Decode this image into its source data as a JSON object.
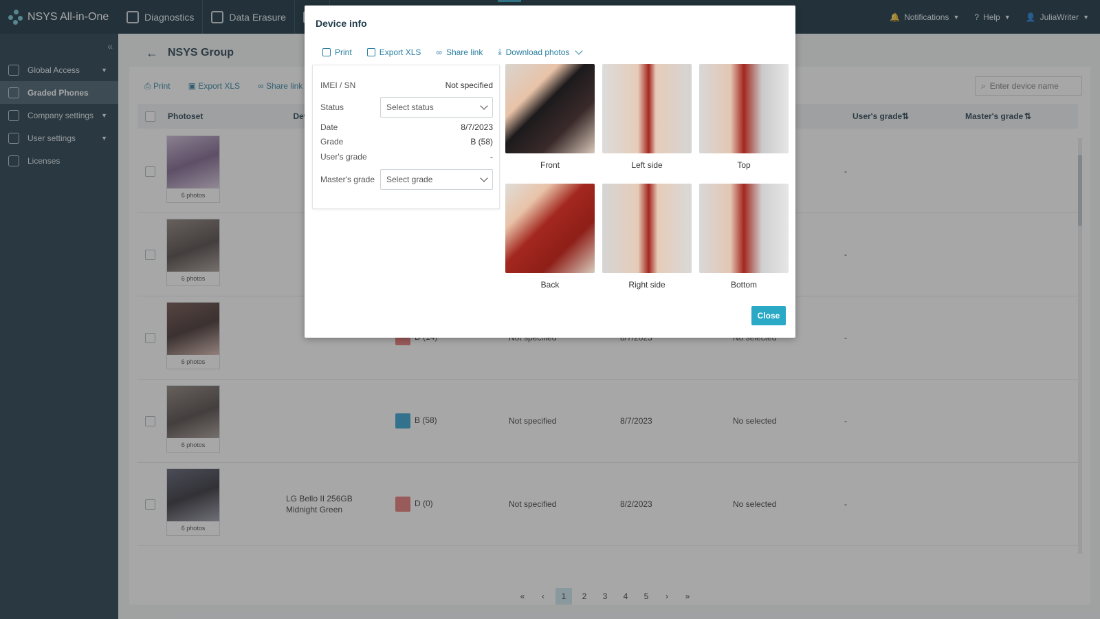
{
  "app": {
    "brand": "NSYS All-in-One",
    "nav": [
      "Diagnostics",
      "Data Erasure"
    ],
    "notifications": "Notifications",
    "help": "Help",
    "user": "JuliaWriter"
  },
  "sidebar": {
    "items": [
      {
        "label": "Global Access",
        "icon": "check-icon",
        "has_caret": true
      },
      {
        "label": "Graded Phones",
        "icon": "phone-icon",
        "active": true
      },
      {
        "label": "Company settings",
        "icon": "sliders-icon",
        "has_caret": true
      },
      {
        "label": "User settings",
        "icon": "gear-icon",
        "has_caret": true
      },
      {
        "label": "Licenses",
        "icon": "document-icon"
      }
    ]
  },
  "page": {
    "title": "NSYS Group",
    "toolbar": {
      "print": "Print",
      "export": "Export XLS",
      "share": "Share link"
    },
    "search_placeholder": "Enter device name",
    "columns": {
      "photoset": "Photoset",
      "device": "Device",
      "users_grade": "User's grade",
      "masters_grade": "Master's grade"
    },
    "rows": [
      {
        "photos": "6 photos",
        "device": "",
        "grade": "",
        "imei": "",
        "date": "",
        "status": "",
        "users_grade": "-"
      },
      {
        "photos": "6 photos",
        "device": "",
        "grade": "",
        "imei": "",
        "date": "",
        "status": "",
        "users_grade": "-"
      },
      {
        "photos": "6 photos",
        "device": "",
        "grade": "D (14)",
        "imei": "Not specified",
        "date": "8/7/2023",
        "status": "No selected",
        "users_grade": "-"
      },
      {
        "photos": "6 photos",
        "device": "",
        "grade": "B (58)",
        "imei": "Not specified",
        "date": "8/7/2023",
        "status": "No selected",
        "users_grade": "-"
      },
      {
        "photos": "6 photos",
        "device": "LG Bello II 256GB Midnight Green",
        "grade": "D (0)",
        "imei": "Not specified",
        "date": "8/2/2023",
        "status": "No selected",
        "users_grade": "-"
      }
    ],
    "pagination": {
      "pages": [
        "1",
        "2",
        "3",
        "4",
        "5"
      ],
      "current": "1",
      "first": "«",
      "prev": "‹",
      "next": "›",
      "last": "»"
    }
  },
  "modal": {
    "title": "Device info",
    "actions": {
      "print": "Print",
      "export": "Export XLS",
      "share": "Share link",
      "download": "Download photos"
    },
    "fields": {
      "imei_label": "IMEI / SN",
      "imei_value": "Not specified",
      "status_label": "Status",
      "status_placeholder": "Select status",
      "date_label": "Date",
      "date_value": "8/7/2023",
      "grade_label": "Grade",
      "grade_value": "B (58)",
      "users_grade_label": "User's grade",
      "users_grade_value": "-",
      "masters_grade_label": "Master's grade",
      "masters_grade_placeholder": "Select grade"
    },
    "photos": [
      {
        "caption": "Front"
      },
      {
        "caption": "Left side"
      },
      {
        "caption": "Top"
      },
      {
        "caption": "Back"
      },
      {
        "caption": "Right side"
      },
      {
        "caption": "Bottom"
      }
    ],
    "close_label": "Close"
  },
  "colors": {
    "accent": "#2aa9c6",
    "grade_d": "#e57373",
    "grade_b": "#2a9fd0",
    "phone_red": "#a3271f"
  }
}
